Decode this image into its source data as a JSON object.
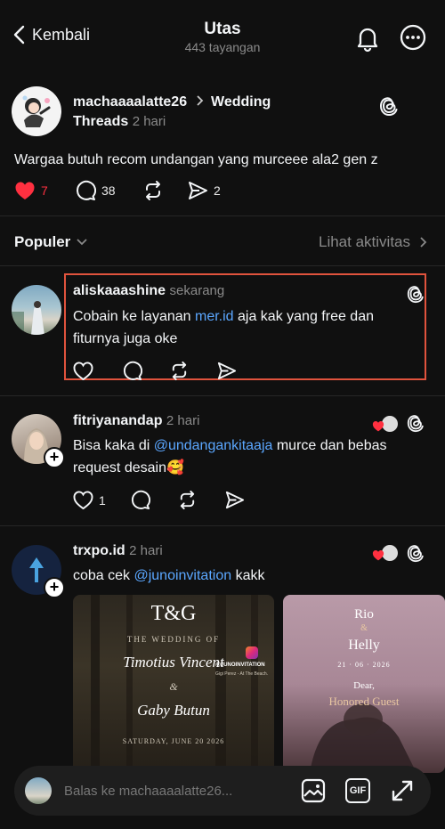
{
  "header": {
    "back_label": "Kembali",
    "title": "Utas",
    "views": "443 tayangan"
  },
  "post": {
    "username": "machaaaalatte26",
    "community": "Wedding Threads",
    "community_first": "Wedding",
    "community_second": "Threads",
    "time": "2 hari",
    "text": "Wargaa butuh recom undangan yang murceee ala2 gen z",
    "likes": "7",
    "comments": "38",
    "shares": "2"
  },
  "sort": {
    "label": "Populer",
    "activity": "Lihat aktivitas"
  },
  "replies": [
    {
      "username": "aliskaaashine",
      "time": "sekarang",
      "text_before": "Cobain ke layanan ",
      "link": "mer.id",
      "text_after": " aja kak yang free dan fiturnya juga oke"
    },
    {
      "username": "fitriyanandap",
      "time": "2 hari",
      "text_before": "Bisa kaka di ",
      "link": "@undangankitaaja",
      "text_after": "  murce dan bebas request desain🥰",
      "likes": "1"
    },
    {
      "username": "trxpo.id",
      "time": "2 hari",
      "text_before": "coba cek ",
      "link": "@junoinvitation",
      "text_after": " kakk"
    }
  ],
  "cards": {
    "card1": {
      "monogram": "T&G",
      "subtitle": "THE WEDDING OF",
      "name1": "Timotius Vincent",
      "amp": "&",
      "name2": "Gaby Butun",
      "date": "SATURDAY, JUNE 20 2026",
      "ig_handle": "@JUNOINVITATION",
      "ig_sub": "Gigi Perez - At The Beach."
    },
    "card2": {
      "name1": "Rio",
      "amp": "&",
      "name2": "Helly",
      "date": "21 · 06 · 2026",
      "dear": "Dear,",
      "guest": "Honored Guest"
    }
  },
  "reply_bar": {
    "placeholder": "Balas ke machaaaalatte26...",
    "gif_label": "GIF"
  },
  "colors": {
    "background": "#101010",
    "accent_link": "#5ba7ff",
    "like_red": "#ff3040",
    "highlight_box": "#e0533d"
  }
}
